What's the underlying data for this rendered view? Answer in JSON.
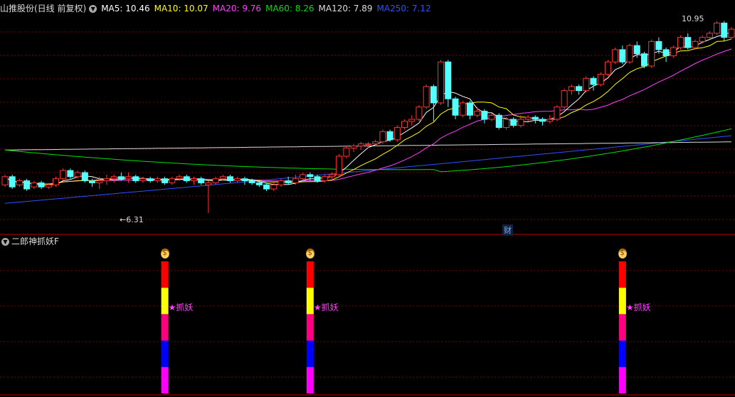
{
  "main_header": {
    "stock_label": "山推股份(日线 前复权)",
    "ma": [
      {
        "label": "MA5: 10.46",
        "color": "#ffffff"
      },
      {
        "label": "MA10: 10.07",
        "color": "#ffff00"
      },
      {
        "label": "MA20: 9.76",
        "color": "#ff40ff"
      },
      {
        "label": "MA60: 8.26",
        "color": "#00e000"
      },
      {
        "label": "MA120: 7.89",
        "color": "#dddddd"
      },
      {
        "label": "MA250: 7.12",
        "color": "#3050ff"
      }
    ]
  },
  "sub_header": {
    "title": "二郎神抓妖F"
  },
  "annotations": {
    "high_label": "10.95",
    "low_label": "6.31",
    "low_arrow": "←",
    "finance_marker": "财"
  },
  "signal": {
    "label": "★抓妖",
    "icon": "money-bag-icon"
  },
  "colors": {
    "up": "#ff3333",
    "down": "#54ffff",
    "grid": "#800000",
    "bar_segments": [
      "#ff0000",
      "#ffff00",
      "#ff0080",
      "#0000ff",
      "#ff00ff"
    ]
  },
  "chart_data": {
    "type": "candlestick",
    "price_range": [
      6.0,
      11.2
    ],
    "candles": [
      [
        7.0,
        7.2,
        6.95,
        7.25
      ],
      [
        7.2,
        6.95,
        6.9,
        7.25
      ],
      [
        7.0,
        7.1,
        6.95,
        7.15
      ],
      [
        7.1,
        6.9,
        6.85,
        7.15
      ],
      [
        6.95,
        7.05,
        6.9,
        7.1
      ],
      [
        7.05,
        6.95,
        6.9,
        7.1
      ],
      [
        6.95,
        7.0,
        6.9,
        7.05
      ],
      [
        7.0,
        7.15,
        6.95,
        7.2
      ],
      [
        7.15,
        7.35,
        7.1,
        7.4
      ],
      [
        7.35,
        7.2,
        7.15,
        7.4
      ],
      [
        7.2,
        7.3,
        7.15,
        7.35
      ],
      [
        7.3,
        7.1,
        7.05,
        7.35
      ],
      [
        7.1,
        7.05,
        6.95,
        7.15
      ],
      [
        7.05,
        7.1,
        6.9,
        7.2
      ],
      [
        7.1,
        7.15,
        7.0,
        7.25
      ],
      [
        7.15,
        7.2,
        7.05,
        7.25
      ],
      [
        7.2,
        7.15,
        7.1,
        7.3
      ],
      [
        7.15,
        7.2,
        7.05,
        7.3
      ],
      [
        7.2,
        7.1,
        7.05,
        7.25
      ],
      [
        7.1,
        7.15,
        7.05,
        7.2
      ],
      [
        7.15,
        7.1,
        7.05,
        7.2
      ],
      [
        7.1,
        7.15,
        7.05,
        7.2
      ],
      [
        7.15,
        7.05,
        7.0,
        7.2
      ],
      [
        7.05,
        7.15,
        7.0,
        7.2
      ],
      [
        7.15,
        7.2,
        7.1,
        7.25
      ],
      [
        7.2,
        7.1,
        7.05,
        7.25
      ],
      [
        7.1,
        7.15,
        7.0,
        7.2
      ],
      [
        7.15,
        7.05,
        7.0,
        7.2
      ],
      [
        7.0,
        7.05,
        6.31,
        7.1
      ],
      [
        7.05,
        7.15,
        7.0,
        7.2
      ],
      [
        7.15,
        7.2,
        7.1,
        7.25
      ],
      [
        7.2,
        7.1,
        7.05,
        7.25
      ],
      [
        7.1,
        7.15,
        7.05,
        7.2
      ],
      [
        7.15,
        7.1,
        7.0,
        7.2
      ],
      [
        7.1,
        7.05,
        7.0,
        7.15
      ],
      [
        7.05,
        7.0,
        6.95,
        7.1
      ],
      [
        7.0,
        6.9,
        6.85,
        7.05
      ],
      [
        6.9,
        7.0,
        6.85,
        7.05
      ],
      [
        7.0,
        7.1,
        6.95,
        7.15
      ],
      [
        7.1,
        7.05,
        7.0,
        7.2
      ],
      [
        7.05,
        7.15,
        7.0,
        7.25
      ],
      [
        7.15,
        7.25,
        7.1,
        7.3
      ],
      [
        7.25,
        7.2,
        7.1,
        7.3
      ],
      [
        7.2,
        7.1,
        7.05,
        7.25
      ],
      [
        7.1,
        7.2,
        7.05,
        7.25
      ],
      [
        7.2,
        7.25,
        7.15,
        7.3
      ],
      [
        7.25,
        7.7,
        7.2,
        7.75
      ],
      [
        7.7,
        7.9,
        7.65,
        7.95
      ],
      [
        7.9,
        7.95,
        7.8,
        8.0
      ],
      [
        7.95,
        8.0,
        7.85,
        8.05
      ],
      [
        8.0,
        8.0,
        7.9,
        8.05
      ],
      [
        8.0,
        8.05,
        7.95,
        8.1
      ],
      [
        8.05,
        8.3,
        8.0,
        8.35
      ],
      [
        8.3,
        8.1,
        8.05,
        8.35
      ],
      [
        8.1,
        8.4,
        8.05,
        8.45
      ],
      [
        8.4,
        8.55,
        8.35,
        8.6
      ],
      [
        8.55,
        8.6,
        8.45,
        8.7
      ],
      [
        8.6,
        8.9,
        8.55,
        8.95
      ],
      [
        8.9,
        9.4,
        8.85,
        9.45
      ],
      [
        9.4,
        9.0,
        8.55,
        9.45
      ],
      [
        9.0,
        10.0,
        8.95,
        10.05
      ],
      [
        10.0,
        9.1,
        8.9,
        10.05
      ],
      [
        9.1,
        8.7,
        8.6,
        9.15
      ],
      [
        8.7,
        9.0,
        8.65,
        9.05
      ],
      [
        9.0,
        8.7,
        8.6,
        9.05
      ],
      [
        8.7,
        8.8,
        8.65,
        8.9
      ],
      [
        8.8,
        8.6,
        8.5,
        8.85
      ],
      [
        8.6,
        8.7,
        8.55,
        8.75
      ],
      [
        8.7,
        8.4,
        8.35,
        8.75
      ],
      [
        8.4,
        8.6,
        8.35,
        8.65
      ],
      [
        8.6,
        8.45,
        8.4,
        8.65
      ],
      [
        8.45,
        8.6,
        8.4,
        8.7
      ],
      [
        8.6,
        8.65,
        8.55,
        8.7
      ],
      [
        8.65,
        8.6,
        8.5,
        8.7
      ],
      [
        8.6,
        8.55,
        8.45,
        8.65
      ],
      [
        8.55,
        8.6,
        8.5,
        8.7
      ],
      [
        8.6,
        8.9,
        8.55,
        8.95
      ],
      [
        8.9,
        9.3,
        8.85,
        9.35
      ],
      [
        9.3,
        9.4,
        9.2,
        9.45
      ],
      [
        9.4,
        9.3,
        9.2,
        9.45
      ],
      [
        9.3,
        9.6,
        9.25,
        9.65
      ],
      [
        9.6,
        9.45,
        9.3,
        9.65
      ],
      [
        9.45,
        9.7,
        9.4,
        9.75
      ],
      [
        9.7,
        10.0,
        9.65,
        10.05
      ],
      [
        10.0,
        10.3,
        9.95,
        10.35
      ],
      [
        10.3,
        10.0,
        9.95,
        10.4
      ],
      [
        10.0,
        10.4,
        9.95,
        10.45
      ],
      [
        10.4,
        10.2,
        10.1,
        10.5
      ],
      [
        10.2,
        9.9,
        9.85,
        10.25
      ],
      [
        9.9,
        10.5,
        9.85,
        10.55
      ],
      [
        10.5,
        10.3,
        10.2,
        10.6
      ],
      [
        10.3,
        10.15,
        10.0,
        10.35
      ],
      [
        10.15,
        10.35,
        10.1,
        10.4
      ],
      [
        10.35,
        10.6,
        10.3,
        10.65
      ],
      [
        10.6,
        10.35,
        10.3,
        10.7
      ],
      [
        10.35,
        10.5,
        10.3,
        10.55
      ],
      [
        10.5,
        10.6,
        10.45,
        10.65
      ],
      [
        10.6,
        10.7,
        10.55,
        10.75
      ],
      [
        10.7,
        10.95,
        10.65,
        11.0
      ],
      [
        10.95,
        10.6,
        10.5,
        11.0
      ],
      [
        10.6,
        10.8,
        10.55,
        10.85
      ]
    ],
    "signal_indices": [
      22,
      42,
      85
    ]
  }
}
